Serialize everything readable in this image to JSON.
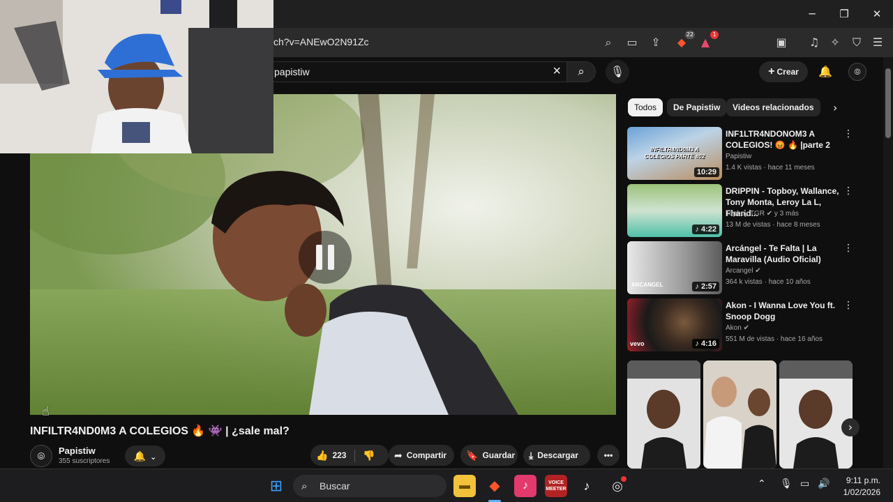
{
  "browser": {
    "url_partial": "ch?v=ANEwO2N91Zc",
    "shields_count": "22",
    "rewards_count": "1",
    "window_controls": [
      "minimize-icon",
      "restore-icon",
      "close-icon"
    ]
  },
  "youtube_header": {
    "search_value": "papistiw",
    "create_label": "Crear"
  },
  "video": {
    "title": "INFILTR4ND0M3 A COLEGIOS 🔥 👾 | ¿sale mal?",
    "channel_name": "Papistiw",
    "subscribers": "355 suscriptores",
    "likes": "223",
    "share_label": "Compartir",
    "save_label": "Guardar",
    "download_label": "Descargar"
  },
  "sidebar": {
    "chips": [
      "Todos",
      "De Papistiw",
      "Videos relacionados"
    ],
    "recommendations": [
      {
        "title": "INF1LTR4NDONOM3 A COLEGIOS! 😡 🔥 |parte 2",
        "channel": "Papistiw",
        "meta": "1.4 K vistas · hace 11 meses",
        "duration": "10:29",
        "thumb_text": "INFILTR4ND0M3 A COLEGIOS PARTE #02"
      },
      {
        "title": "DRIPPIN - Topboy, Wallance, Tony Monta, Leroy La L, Fharid...",
        "channel": "Topboy TGR ✔ y 3 más",
        "meta": "13 M de vistas · hace 8 meses",
        "duration": "4:22",
        "thumb_text": ""
      },
      {
        "title": "Arcángel - Te Falta | La Maravilla (Audio Oficial)",
        "channel": "Arcangel ✔",
        "meta": "364 k vistas · hace 10 años",
        "duration": "2:57",
        "thumb_text": "ARCANGEL"
      },
      {
        "title": "Akon - I Wanna Love You ft. Snoop Dogg",
        "channel": "Akon ✔",
        "meta": "551 M de vistas · hace 16 años",
        "duration": "4:16",
        "thumb_text": "vevo"
      }
    ]
  },
  "taskbar": {
    "search_label": "Buscar",
    "time": "9:11 p.m.",
    "date": "1/02/2026",
    "voicemeeter_label": "VOICE MEETER"
  },
  "colors": {
    "background": "#0f0f0f",
    "chip_bg": "#272727",
    "accent_red": "#ff0033",
    "taskbar": "#1d1d1f"
  }
}
